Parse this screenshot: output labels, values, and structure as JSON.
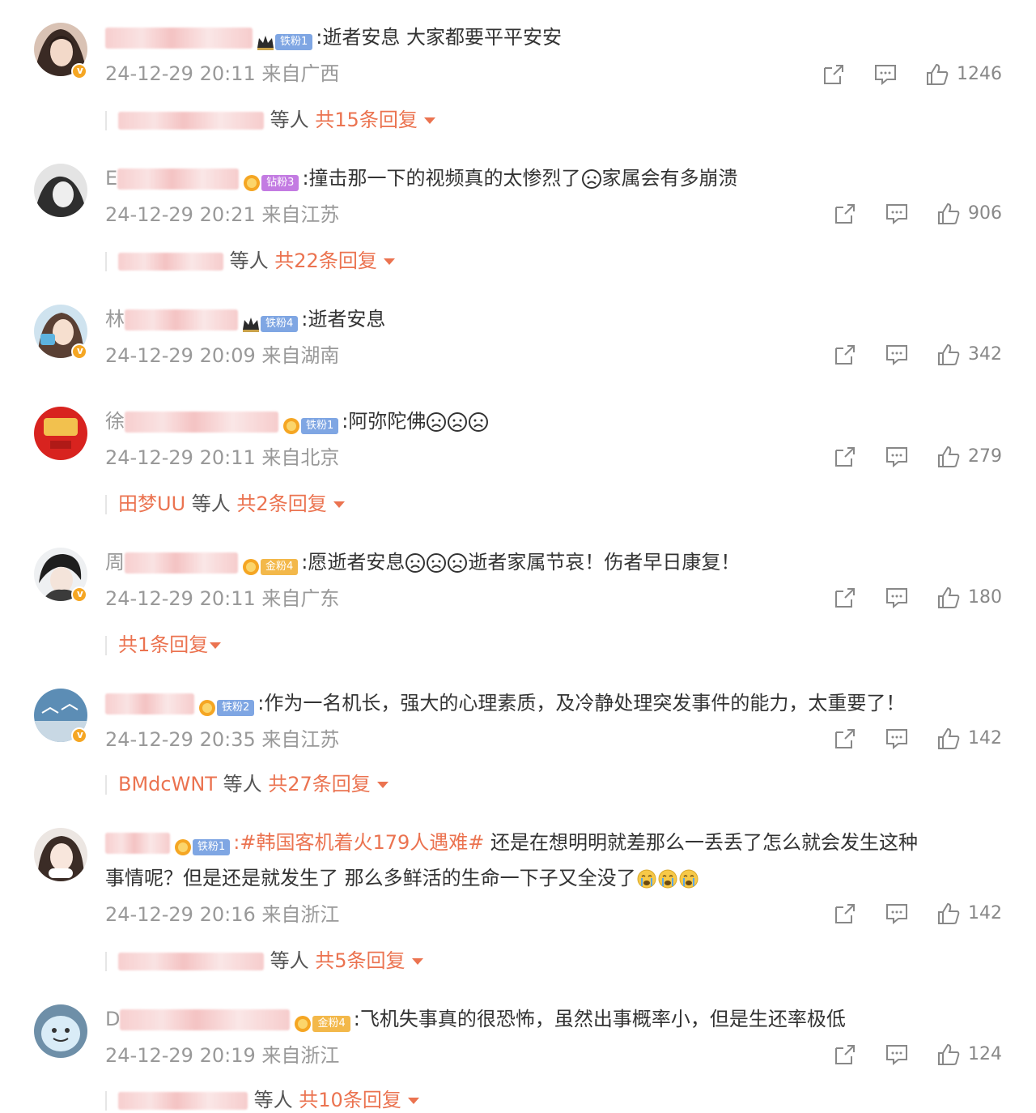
{
  "colors": {
    "accent_orange": "#eb7350",
    "meta_gray": "#999999",
    "text": "#333333"
  },
  "comments": [
    {
      "fan_label": "铁粉1",
      "text": ":逝者安息 大家都要平平安安",
      "time": "24-12-29 20:11",
      "location": "来自广西",
      "likes": "1246",
      "reply_prefix": "",
      "reply_mid": "等人",
      "reply_count": "共15条回复"
    },
    {
      "name_first": "E",
      "fan_label": "钻粉3",
      "text": ":撞击那一下的视频真的太惨烈了",
      "text_after": "家属会有多崩溃",
      "time": "24-12-29 20:21",
      "location": "来自江苏",
      "likes": "906",
      "reply_prefix": "",
      "reply_mid": "等人",
      "reply_count": "共22条回复"
    },
    {
      "name_first": "林",
      "fan_label": "铁粉4",
      "text": ":逝者安息",
      "time": "24-12-29 20:09",
      "location": "来自湖南",
      "likes": "342"
    },
    {
      "name_first": "徐",
      "fan_label": "铁粉1",
      "text": ":阿弥陀佛",
      "time": "24-12-29 20:11",
      "location": "来自北京",
      "likes": "279",
      "reply_prefix": "田梦UU",
      "reply_mid": "等人",
      "reply_count": "共2条回复"
    },
    {
      "name_first": "周",
      "fan_label": "金粉4",
      "text": ":愿逝者安息",
      "text_after": "逝者家属节哀！伤者早日康复！",
      "time": "24-12-29 20:11",
      "location": "来自广东",
      "likes": "180",
      "reply_prefix": "",
      "reply_mid": "",
      "reply_count": "共1条回复"
    },
    {
      "fan_label": "铁粉2",
      "text": ":作为一名机长，强大的心理素质，及冷静处理突发事件的能力，太重要了！",
      "time": "24-12-29 20:35",
      "location": "来自江苏",
      "likes": "142",
      "reply_prefix": "BMdcWNT",
      "reply_mid": "等人",
      "reply_count": "共27条回复"
    },
    {
      "fan_label": "铁粉1",
      "hashtag": ":#韩国客机着火179人遇难#",
      "text": " 还是在想明明就差那么一丢丢了怎么就会发生这种",
      "text_line2": "事情呢？但是还是就发生了 那么多鲜活的生命一下子又全没了",
      "time": "24-12-29 20:16",
      "location": "来自浙江",
      "likes": "142",
      "reply_prefix": "",
      "reply_mid": "等人",
      "reply_count": "共5条回复"
    },
    {
      "name_first": "D",
      "fan_label": "金粉4",
      "text": ":飞机失事真的很恐怖，虽然出事概率小，但是生还率极低",
      "time": "24-12-29 20:19",
      "location": "来自浙江",
      "likes": "124",
      "reply_prefix": "",
      "reply_mid": "等人",
      "reply_count": "共10条回复"
    }
  ],
  "icons": {
    "share": "share-icon",
    "comment": "comment-icon",
    "like": "like-icon",
    "crying": "crying-emoji-icon",
    "sad": "sad-emoji-icon"
  }
}
